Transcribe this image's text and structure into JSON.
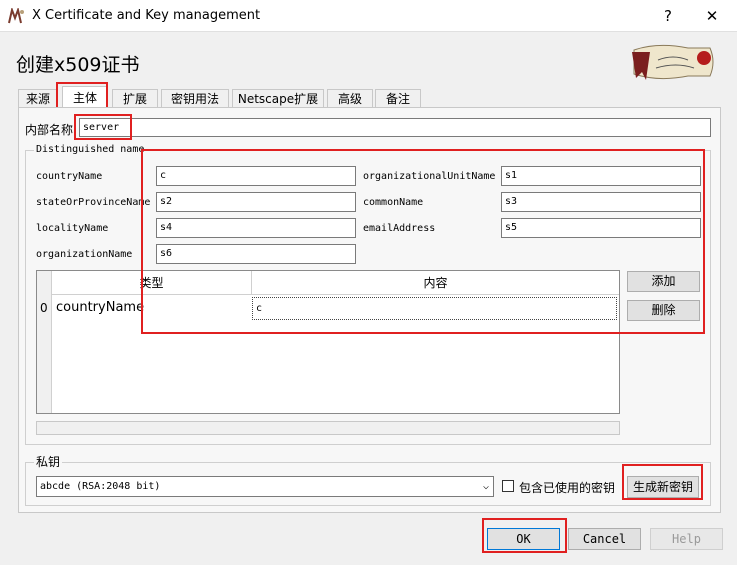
{
  "window": {
    "title": "X Certificate and Key management",
    "help_glyph": "?",
    "close_glyph": "✕"
  },
  "dialog": {
    "heading": "创建x509证书"
  },
  "tabs": [
    {
      "label": "来源",
      "active": false
    },
    {
      "label": "主体",
      "active": true
    },
    {
      "label": "扩展",
      "active": false
    },
    {
      "label": "密钥用法",
      "active": false
    },
    {
      "label": "Netscape扩展",
      "active": false
    },
    {
      "label": "高级",
      "active": false
    },
    {
      "label": "备注",
      "active": false
    }
  ],
  "subject": {
    "internal_name_label": "内部名称",
    "internal_name_value": "server",
    "dn_group_title": "Distinguished name",
    "fields": {
      "countryName": {
        "label": "countryName",
        "value": "c"
      },
      "organizationalUnitName": {
        "label": "organizationalUnitName",
        "value": "s1"
      },
      "stateOrProvinceName": {
        "label": "stateOrProvinceName",
        "value": "s2"
      },
      "commonName": {
        "label": "commonName",
        "value": "s3"
      },
      "localityName": {
        "label": "localityName",
        "value": "s4"
      },
      "emailAddress": {
        "label": "emailAddress",
        "value": "s5"
      },
      "organizationName": {
        "label": "organizationName",
        "value": "s6"
      }
    },
    "table": {
      "columns": [
        "类型",
        "内容"
      ],
      "rows": [
        {
          "index": "0",
          "type": "countryName",
          "content": "c"
        }
      ]
    },
    "add_button": "添加",
    "delete_button": "删除"
  },
  "private_key": {
    "group_title": "私钥",
    "selected_key": "abcde (RSA:2048 bit)",
    "include_used_label": "包含已使用的密钥",
    "include_used_checked": false,
    "generate_button": "生成新密钥"
  },
  "footer": {
    "ok": "OK",
    "cancel": "Cancel",
    "help": "Help"
  }
}
